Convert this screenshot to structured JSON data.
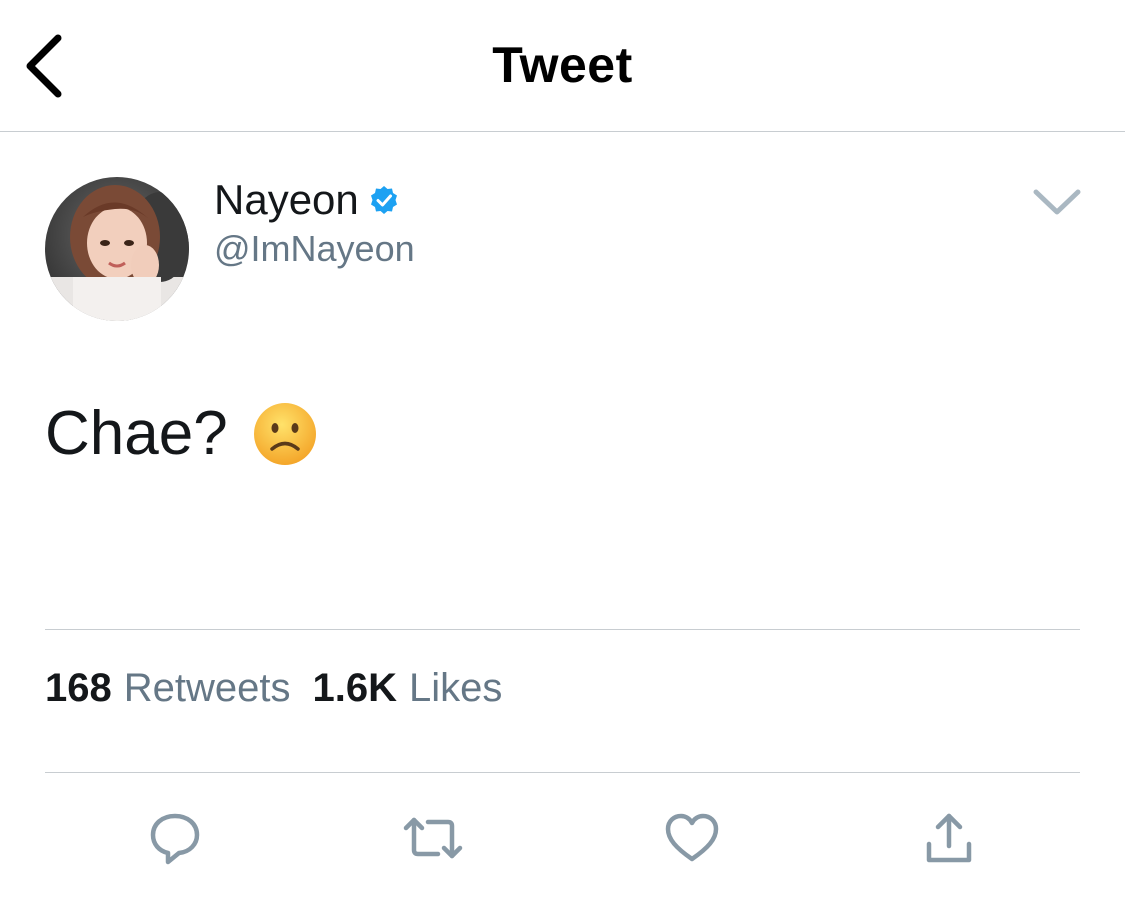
{
  "header": {
    "title": "Tweet"
  },
  "tweet": {
    "author": {
      "display_name": "Nayeon",
      "handle": "@ImNayeon",
      "verified": true
    },
    "text": "Chae?",
    "emoji": "frowning-face-emoji"
  },
  "stats": {
    "retweets_count": "168",
    "retweets_label": "Retweets",
    "likes_count": "1.6K",
    "likes_label": "Likes"
  },
  "actions": [
    "reply-icon",
    "retweet-icon",
    "like-icon",
    "share-icon"
  ],
  "colors": {
    "text": "#14171a",
    "secondary_text": "#657786",
    "verified_blue": "#1da1f2",
    "divider": "#c8cdd1",
    "action_gray": "#8899a6"
  }
}
